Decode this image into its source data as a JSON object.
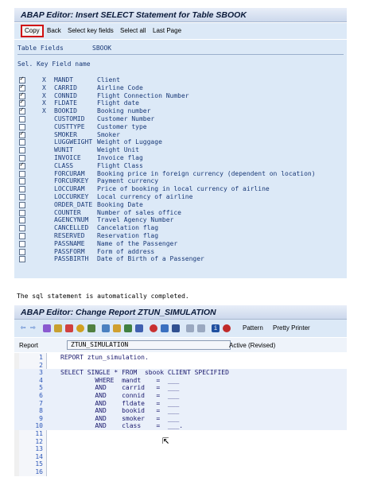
{
  "dialog1": {
    "title": "ABAP Editor: Insert SELECT Statement for Table SBOOK",
    "toolbar": [
      "Copy",
      "Back",
      "Select key fields",
      "Select all",
      "Last Page"
    ],
    "table_fields_label": "Table Fields",
    "table_name": "SBOOK",
    "column_header": "Sel. Key Field name",
    "fields": [
      {
        "checked": true,
        "key": "X",
        "name": "MANDT",
        "desc": "Client"
      },
      {
        "checked": true,
        "key": "X",
        "name": "CARRID",
        "desc": "Airline Code"
      },
      {
        "checked": true,
        "key": "X",
        "name": "CONNID",
        "desc": "Flight Connection Number"
      },
      {
        "checked": true,
        "key": "X",
        "name": "FLDATE",
        "desc": "Flight date"
      },
      {
        "checked": true,
        "key": "X",
        "name": "BOOKID",
        "desc": "Booking number"
      },
      {
        "checked": false,
        "key": "",
        "name": "CUSTOMID",
        "desc": "Customer Number"
      },
      {
        "checked": false,
        "key": "",
        "name": "CUSTTYPE",
        "desc": "Customer type"
      },
      {
        "checked": true,
        "key": "",
        "name": "SMOKER",
        "desc": "Smoker"
      },
      {
        "checked": false,
        "key": "",
        "name": "LUGGWEIGHT",
        "desc": "Weight of Luggage"
      },
      {
        "checked": false,
        "key": "",
        "name": "WUNIT",
        "desc": "Weight Unit"
      },
      {
        "checked": false,
        "key": "",
        "name": "INVOICE",
        "desc": "Invoice flag"
      },
      {
        "checked": true,
        "key": "",
        "name": "CLASS",
        "desc": "Flight Class"
      },
      {
        "checked": false,
        "key": "",
        "name": "FORCURAM",
        "desc": "Booking price in foreign currency (dependent on location)"
      },
      {
        "checked": false,
        "key": "",
        "name": "FORCURKEY",
        "desc": "Payment currency"
      },
      {
        "checked": false,
        "key": "",
        "name": "LOCCURAM",
        "desc": "Price of booking in local currency of airline"
      },
      {
        "checked": false,
        "key": "",
        "name": "LOCCURKEY",
        "desc": "Local currency of airline"
      },
      {
        "checked": false,
        "key": "",
        "name": "ORDER_DATE",
        "desc": "Booking Date"
      },
      {
        "checked": false,
        "key": "",
        "name": "COUNTER",
        "desc": "Number of sales office"
      },
      {
        "checked": false,
        "key": "",
        "name": "AGENCYNUM",
        "desc": "Travel Agency Number"
      },
      {
        "checked": false,
        "key": "",
        "name": "CANCELLED",
        "desc": "Cancelation flag"
      },
      {
        "checked": false,
        "key": "",
        "name": "RESERVED",
        "desc": "Reservation flag"
      },
      {
        "checked": false,
        "key": "",
        "name": "PASSNAME",
        "desc": "Name of the Passenger"
      },
      {
        "checked": false,
        "key": "",
        "name": "PASSFORM",
        "desc": "Form of address"
      },
      {
        "checked": false,
        "key": "",
        "name": "PASSBIRTH",
        "desc": "Date of Birth of a Passenger"
      }
    ]
  },
  "caption": "The sql statement is automatically completed.",
  "editor": {
    "title": "ABAP Editor: Change Report ZTUN_SIMULATION",
    "pattern_label": "Pattern",
    "pretty_printer_label": "Pretty Printer",
    "report_label": "Report",
    "report_name": "ZTUN_SIMULATION",
    "status": "Active (Revised)",
    "lines": [
      {
        "n": "1",
        "text": "REPORT ztun_simulation."
      },
      {
        "n": "2",
        "text": ""
      },
      {
        "n": "3",
        "text": "SELECT SINGLE * FROM  sbook CLIENT SPECIFIED"
      },
      {
        "n": "4",
        "text": "         WHERE  mandt    =  ___"
      },
      {
        "n": "5",
        "text": "         AND    carrid   =  ___"
      },
      {
        "n": "6",
        "text": "         AND    connid   =  ___"
      },
      {
        "n": "7",
        "text": "         AND    fldate   =  ___"
      },
      {
        "n": "8",
        "text": "         AND    bookid   =  ___"
      },
      {
        "n": "9",
        "text": "         AND    smoker   =  ___"
      },
      {
        "n": "10",
        "text": "         AND    class    =  ___."
      },
      {
        "n": "11",
        "text": ""
      },
      {
        "n": "12",
        "text": ""
      },
      {
        "n": "13",
        "text": ""
      },
      {
        "n": "14",
        "text": ""
      },
      {
        "n": "15",
        "text": ""
      },
      {
        "n": "16",
        "text": ""
      }
    ]
  }
}
